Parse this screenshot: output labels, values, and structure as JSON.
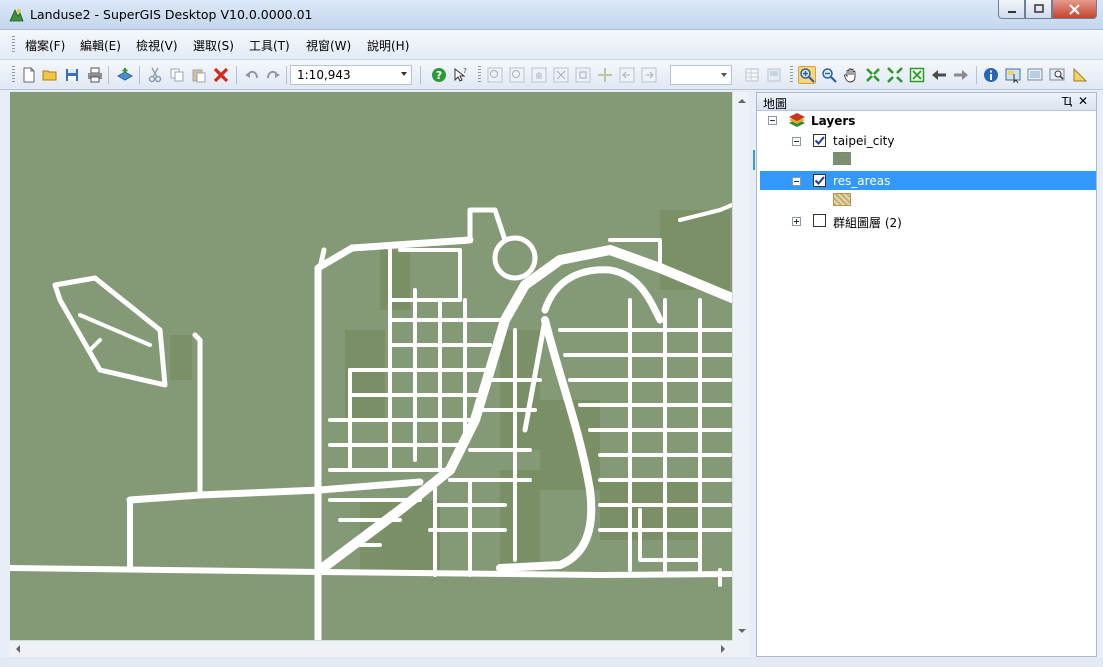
{
  "window": {
    "title": "Landuse2 - SuperGIS Desktop V10.0.0000.01"
  },
  "menu": {
    "items": [
      {
        "label": "檔案(F)"
      },
      {
        "label": "編輯(E)"
      },
      {
        "label": "檢視(V)"
      },
      {
        "label": "選取(S)"
      },
      {
        "label": "工具(T)"
      },
      {
        "label": "視窗(W)"
      },
      {
        "label": "說明(H)"
      }
    ]
  },
  "toolbar": {
    "scale_value": "1:10,943",
    "combo_value": ""
  },
  "panel": {
    "title": "地圖",
    "pin_glyph": "Ҵ",
    "close_glyph": "✕"
  },
  "layers": {
    "root_label": "Layers",
    "items": [
      {
        "label": "taipei_city",
        "checked": true,
        "swatch": "#7c8f6e"
      },
      {
        "label": "res_areas",
        "checked": true,
        "selected": true,
        "swatch": "#c8ad6e"
      },
      {
        "label": "群組圖層 (2)",
        "checked": false,
        "collapsed": true
      }
    ]
  },
  "colors": {
    "map_background": "#849a76",
    "road": "#ffffff",
    "selection": "#3399ff",
    "residential": "#7a8f68"
  }
}
